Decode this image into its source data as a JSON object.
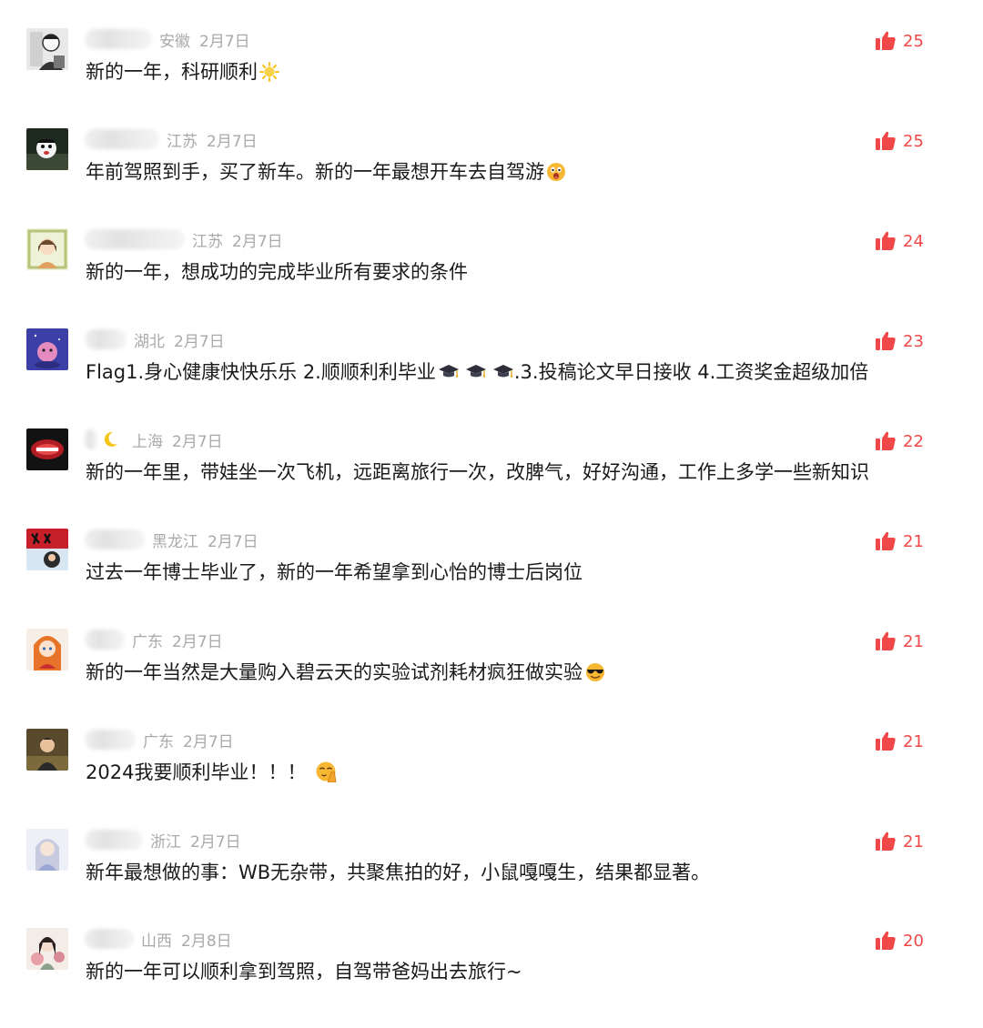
{
  "colors": {
    "accent_like": "#f04848",
    "meta_text": "#a9a9a9",
    "body_text": "#1a1a1a"
  },
  "comments": [
    {
      "region": "安徽",
      "date": "2月7日",
      "text": "新的一年，科研顺利",
      "emoji": "sun-icon",
      "likes": "25"
    },
    {
      "region": "江苏",
      "date": "2月7日",
      "text": "年前驾照到手，买了新车。新的一年最想开车去自驾游",
      "emoji": "surprised-face-icon",
      "likes": "25"
    },
    {
      "region": "江苏",
      "date": "2月7日",
      "text": "新的一年，想成功的完成毕业所有要求的条件",
      "emoji": "",
      "likes": "24"
    },
    {
      "region": "湖北",
      "date": "2月7日",
      "text_parts": [
        "Flag1.身心健康快快乐乐 2.顺顺利利毕业",
        ".3.投稿论文早日接收 4.工资奖金超级加倍"
      ],
      "emoji": "graduation-cap-icon",
      "likes": "23"
    },
    {
      "region": "上海",
      "date": "2月7日",
      "text": "新的一年里，带娃坐一次飞机，远距离旅行一次，改脾气，好好沟通，工作上多学一些新知识",
      "emoji": "",
      "name_emoji": "crescent-moon-icon",
      "likes": "22"
    },
    {
      "region": "黑龙江",
      "date": "2月7日",
      "text": "过去一年博士毕业了，新的一年希望拿到心怡的博士后岗位",
      "emoji": "",
      "likes": "21"
    },
    {
      "region": "广东",
      "date": "2月7日",
      "text": "新的一年当然是大量购入碧云天的实验试剂耗材疯狂做实验",
      "emoji": "sunglasses-face-icon",
      "likes": "21"
    },
    {
      "region": "广东",
      "date": "2月7日",
      "text": "2024我要顺利毕业！！！",
      "emoji": "praying-face-icon",
      "likes": "21"
    },
    {
      "region": "浙江",
      "date": "2月7日",
      "text": "新年最想做的事：WB无杂带，共聚焦拍的好，小鼠嘎嘎生，结果都显著。",
      "emoji": "",
      "likes": "21"
    },
    {
      "region": "山西",
      "date": "2月8日",
      "text": "新的一年可以顺利拿到驾照，自驾带爸妈出去旅行~",
      "emoji": "",
      "likes": "20"
    }
  ]
}
